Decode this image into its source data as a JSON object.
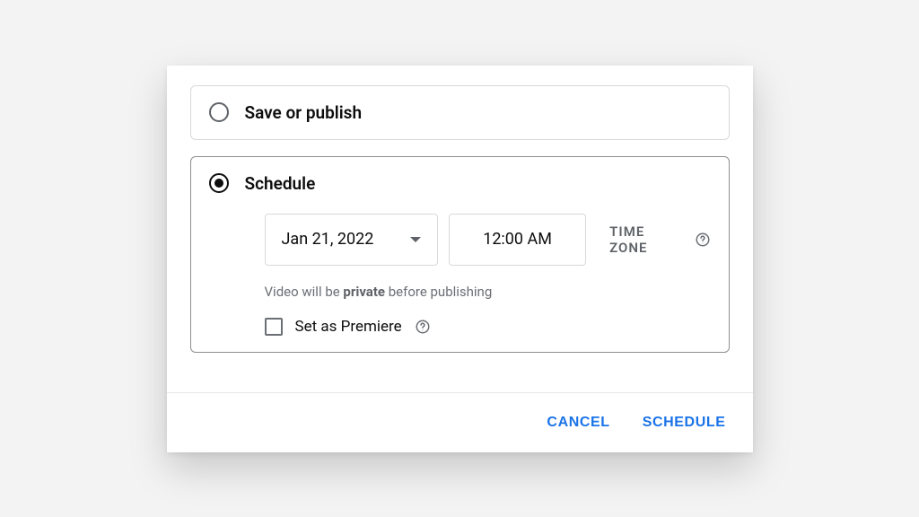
{
  "options": {
    "save_publish": {
      "title": "Save or publish",
      "selected": false
    },
    "schedule": {
      "title": "Schedule",
      "selected": true
    }
  },
  "schedule": {
    "date": "Jan 21, 2022",
    "time": "12:00 AM",
    "timezone_label": "TIME ZONE",
    "note_prefix": "Video will be ",
    "note_bold": "private",
    "note_suffix": " before publishing",
    "premiere_label": "Set as Premiere",
    "premiere_checked": false
  },
  "footer": {
    "cancel": "CANCEL",
    "confirm": "SCHEDULE"
  }
}
